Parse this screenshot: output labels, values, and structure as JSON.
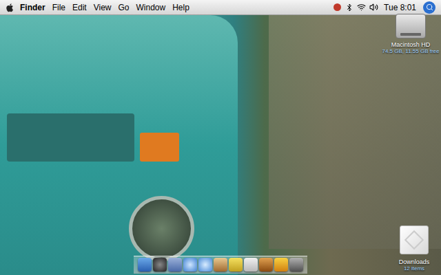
{
  "menu_bar": {
    "app": "Finder",
    "items": [
      "File",
      "Edit",
      "View",
      "Go",
      "Window",
      "Help"
    ],
    "clock": "Tue 8:01"
  },
  "desktop_icons": [
    {
      "label": "Macintosh HD",
      "info": "74.5 GB, 11.55 GB free"
    }
  ],
  "stack": {
    "label": "Downloads",
    "info": "12 items"
  }
}
